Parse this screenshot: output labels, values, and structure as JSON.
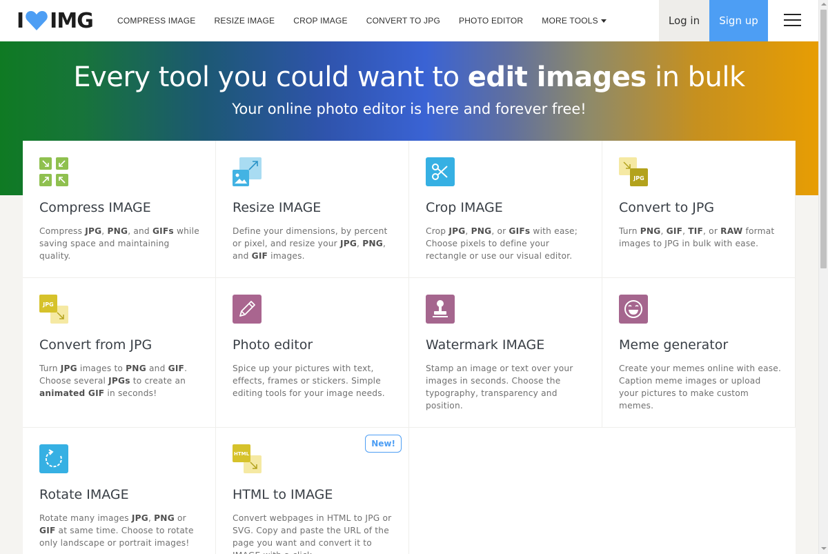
{
  "header": {
    "logo_text": "I ❤ IMG",
    "nav": [
      {
        "label": "COMPRESS IMAGE"
      },
      {
        "label": "RESIZE IMAGE"
      },
      {
        "label": "CROP IMAGE"
      },
      {
        "label": "CONVERT TO JPG"
      },
      {
        "label": "PHOTO EDITOR"
      },
      {
        "label": "MORE TOOLS"
      }
    ],
    "login_label": "Log in",
    "signup_label": "Sign up",
    "menu_icon": "hamburger-menu-icon"
  },
  "hero": {
    "title_start": "Every tool you could want to ",
    "title_bold": "edit images",
    "title_end": " in bulk",
    "subtitle": "Your online photo editor is here and forever free!"
  },
  "tools": [
    {
      "title": "Compress IMAGE",
      "desc_html": "Compress <b>JPG</b>, <b>PNG</b>, and <b>GIFs</b> while saving space and maintaining quality.",
      "icon": "compress-icon",
      "color": "#8fc04f"
    },
    {
      "title": "Resize IMAGE",
      "desc_html": "Define your dimensions, by percent or pixel, and resize your <b>JPG</b>, <b>PNG</b>, and <b>GIF</b> images.",
      "icon": "resize-icon",
      "color": "#43b3e3"
    },
    {
      "title": "Crop IMAGE",
      "desc_html": "Crop <b>JPG</b>, <b>PNG</b>, or <b>GIFs</b> with ease; Choose pixels to define your rectangle or use our visual editor.",
      "icon": "scissors-icon",
      "color": "#36b0e3"
    },
    {
      "title": "Convert to JPG",
      "desc_html": "Turn <b>PNG</b>, <b>GIF</b>, <b>TIF</b>, or <b>RAW</b> format images to JPG in bulk with ease.",
      "icon": "convert-to-jpg-icon",
      "color": "#b3a21c"
    },
    {
      "title": "Convert from JPG",
      "desc_html": "Turn <b>JPG</b> images to <b>PNG</b> and <b>GIF</b>. Choose several <b>JPGs</b> to create an <b>animated GIF</b> in seconds!",
      "icon": "convert-from-jpg-icon",
      "color": "#d6c22b"
    },
    {
      "title": "Photo editor",
      "desc_html": "Spice up your pictures with text, effects, frames or stickers. Simple editing tools for your image needs.",
      "icon": "pencil-icon",
      "color": "#a9658f"
    },
    {
      "title": "Watermark IMAGE",
      "desc_html": "Stamp an image or text over your images in seconds. Choose the typography, transparency and position.",
      "icon": "stamp-icon",
      "color": "#a5668e"
    },
    {
      "title": "Meme generator",
      "desc_html": "Create your memes online with ease. Caption meme images or upload your pictures to make custom memes.",
      "icon": "laughing-face-icon",
      "color": "#a5668e"
    },
    {
      "title": "Rotate IMAGE",
      "desc_html": "Rotate many images <b>JPG</b>, <b>PNG</b> or <b>GIF</b> at same time. Choose to rotate only landscape or portrait images!",
      "icon": "rotate-icon",
      "color": "#36b0e3"
    },
    {
      "title": "HTML to IMAGE",
      "desc_html": "Convert webpages in HTML to JPG or SVG. Copy and paste the URL of the page you want and convert it to IMAGE with a click.",
      "icon": "html-to-image-icon",
      "color": "#d6c22b",
      "badge": "New!"
    }
  ],
  "icon_text": {
    "jpg": "JPG",
    "html": "HTML"
  }
}
